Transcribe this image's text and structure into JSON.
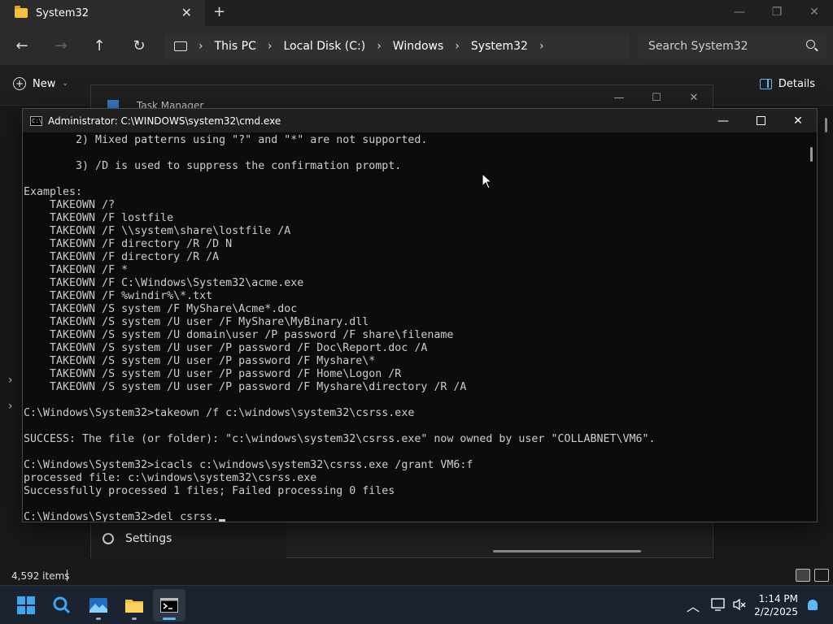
{
  "explorer": {
    "tab_title": "System32",
    "breadcrumb": [
      "This PC",
      "Local Disk (C:)",
      "Windows",
      "System32"
    ],
    "search_placeholder": "Search System32",
    "new_label": "New",
    "details_label": "Details",
    "status_count": "4,592 items"
  },
  "taskmgr": {
    "title": "Task Manager",
    "settings_label": "Settings"
  },
  "cmd": {
    "title": "Administrator: C:\\WINDOWS\\system32\\cmd.exe",
    "lines": [
      "        2) Mixed patterns using \"?\" and \"*\" are not supported.",
      "",
      "        3) /D is used to suppress the confirmation prompt.",
      "",
      "Examples:",
      "    TAKEOWN /?",
      "    TAKEOWN /F lostfile",
      "    TAKEOWN /F \\\\system\\share\\lostfile /A",
      "    TAKEOWN /F directory /R /D N",
      "    TAKEOWN /F directory /R /A",
      "    TAKEOWN /F *",
      "    TAKEOWN /F C:\\Windows\\System32\\acme.exe",
      "    TAKEOWN /F %windir%\\*.txt",
      "    TAKEOWN /S system /F MyShare\\Acme*.doc",
      "    TAKEOWN /S system /U user /F MyShare\\MyBinary.dll",
      "    TAKEOWN /S system /U domain\\user /P password /F share\\filename",
      "    TAKEOWN /S system /U user /P password /F Doc\\Report.doc /A",
      "    TAKEOWN /S system /U user /P password /F Myshare\\*",
      "    TAKEOWN /S system /U user /P password /F Home\\Logon /R",
      "    TAKEOWN /S system /U user /P password /F Myshare\\directory /R /A",
      "",
      "C:\\Windows\\System32>takeown /f c:\\windows\\system32\\csrss.exe",
      "",
      "SUCCESS: The file (or folder): \"c:\\windows\\system32\\csrss.exe\" now owned by user \"COLLABNET\\VM6\".",
      "",
      "C:\\Windows\\System32>icacls c:\\windows\\system32\\csrss.exe /grant VM6:f",
      "processed file: c:\\windows\\system32\\csrss.exe",
      "Successfully processed 1 files; Failed processing 0 files",
      ""
    ],
    "current_input": "C:\\Windows\\System32>del csrss."
  },
  "taskbar": {
    "time": "1:14 PM",
    "date": "2/2/2025"
  },
  "icons": {
    "accent": "#3ea6f0"
  }
}
